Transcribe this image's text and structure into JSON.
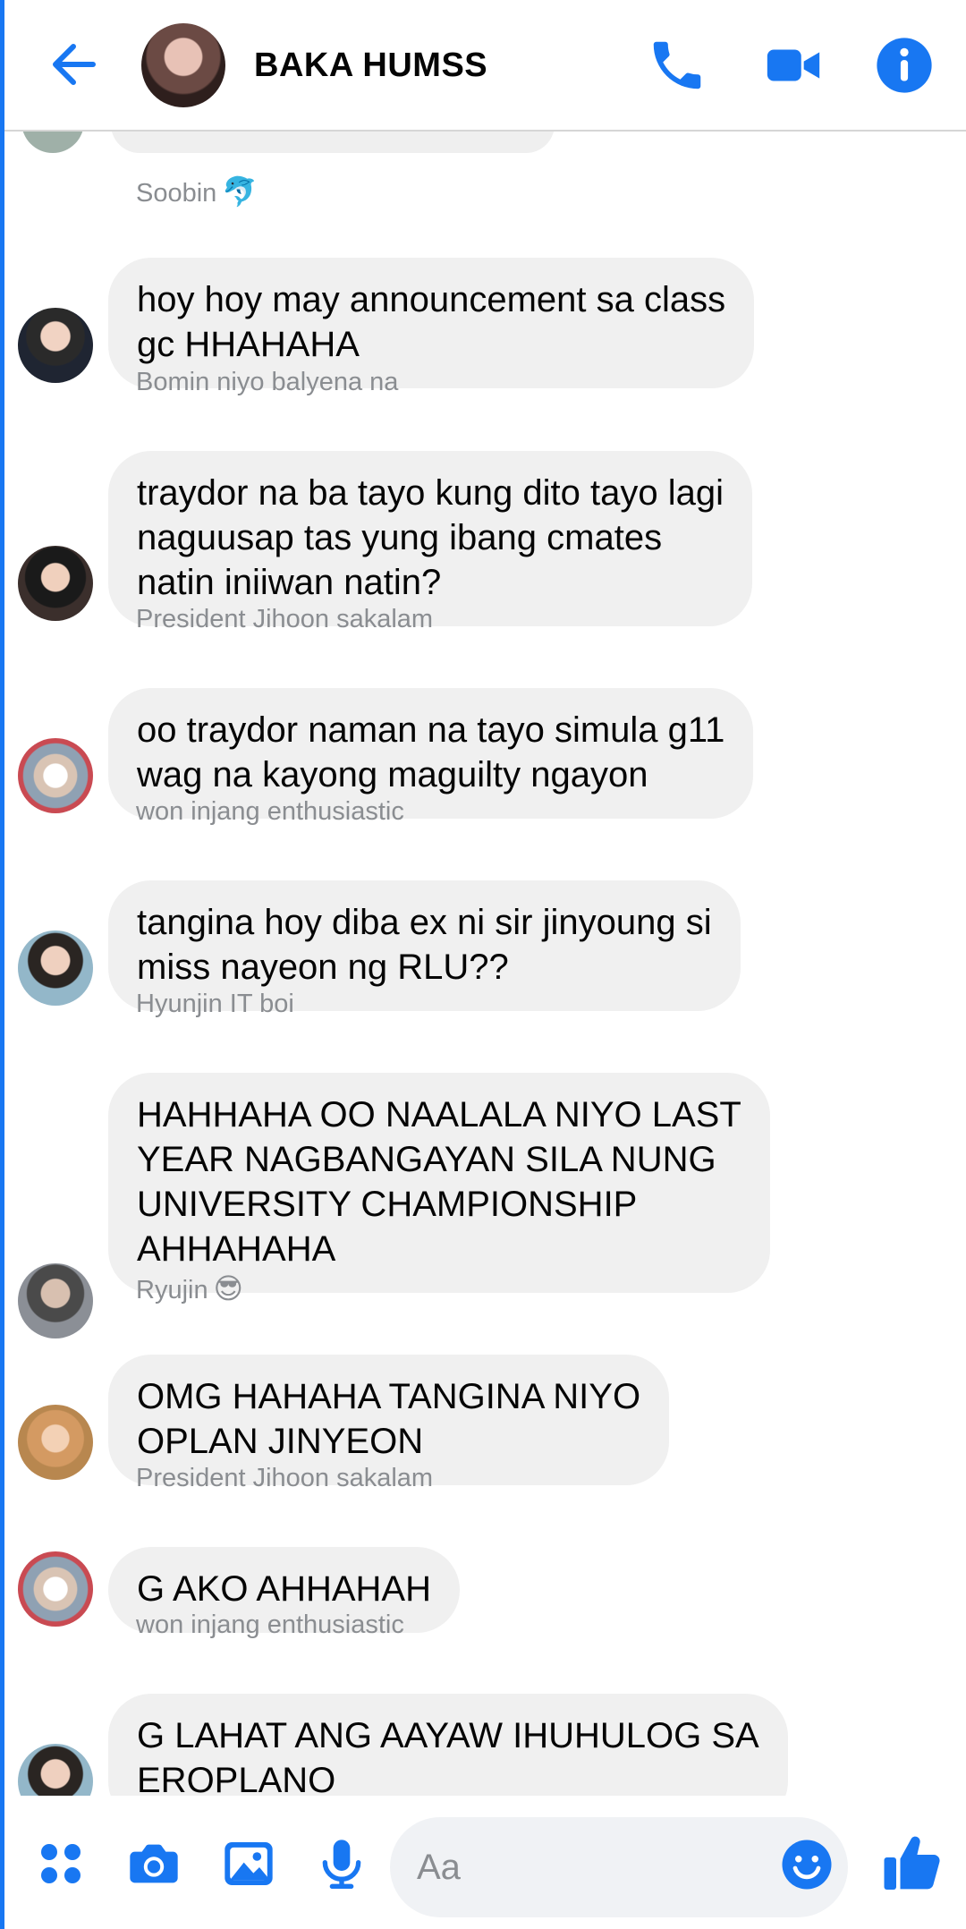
{
  "header": {
    "title": "BAKA HUMSS",
    "icons": {
      "back": "arrow-left-icon",
      "call": "phone-icon",
      "video": "video-camera-icon",
      "info": "info-icon"
    }
  },
  "messages": [
    {
      "sender": "Soobin",
      "sender_emoji": "🐬",
      "lines": [
        "hoy hoy may announcement sa class",
        "gc HHAHAHA"
      ]
    },
    {
      "sender": "Bomin niyo balyena na",
      "sender_emoji": "",
      "lines": [
        "traydor na ba tayo kung dito tayo lagi",
        "naguusap tas yung ibang cmates",
        "natin iniiwan natin?"
      ]
    },
    {
      "sender": "President Jihoon sakalam",
      "sender_emoji": "",
      "lines": [
        "oo traydor naman na tayo simula g11",
        "wag na kayong maguilty ngayon"
      ]
    },
    {
      "sender": "won injang enthusiastic",
      "sender_emoji": "",
      "lines": [
        "tangina hoy diba ex ni sir jinyoung si",
        "miss nayeon ng RLU??"
      ]
    },
    {
      "sender": "Hyunjin IT boi",
      "sender_emoji": "",
      "lines": [
        "HAHHAHA OO NAALALA NIYO LAST",
        "YEAR NAGBANGAYAN SILA NUNG",
        "UNIVERSITY CHAMPIONSHIP",
        "AHHAHAHA"
      ]
    },
    {
      "sender": "Ryujin",
      "sender_emoji": "😎",
      "lines": [
        "OMG HAHAHA TANGINA NIYO",
        "OPLAN JINYEON"
      ]
    },
    {
      "sender": "President Jihoon sakalam",
      "sender_emoji": "",
      "lines": [
        "G AKO AHHAHAH"
      ]
    },
    {
      "sender": "won injang enthusiastic",
      "sender_emoji": "",
      "lines": [
        "G LAHAT ANG AAYAW IHUHULOG SA",
        "EROPLANO"
      ]
    }
  ],
  "composer": {
    "placeholder": "Aa",
    "icons": [
      "apps-icon",
      "camera-icon",
      "image-icon",
      "microphone-icon",
      "emoji-icon",
      "thumbs-up-icon"
    ]
  },
  "colors": {
    "accent": "#1877f2",
    "bubble": "#f0f0f0",
    "sender": "#8a8d91"
  }
}
